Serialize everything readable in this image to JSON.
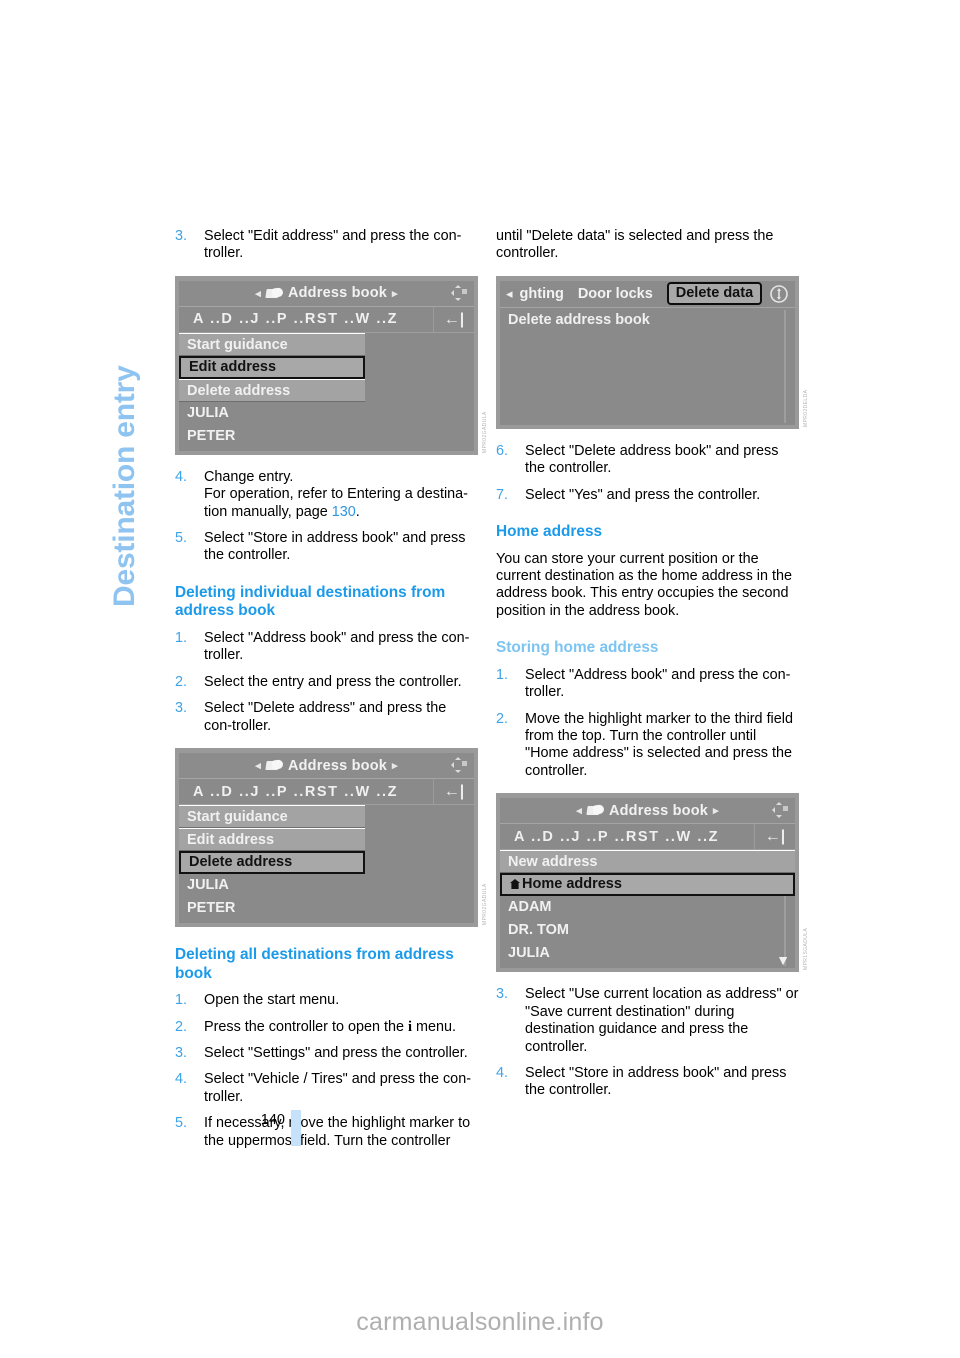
{
  "page": {
    "chapter_title": "Destination entry",
    "page_number": "140",
    "watermark": "carmanualsonline.info"
  },
  "left_column": {
    "step3": {
      "num": "3.",
      "text": "Select \"Edit address\" and press the con-troller."
    },
    "figure1": {
      "title": "Address book",
      "alpha": "A ..D ..J ..P ..RST ..W ..Z",
      "back_arrow": "←|",
      "rows": [
        {
          "label": "Start guidance",
          "state": "boxed"
        },
        {
          "label": "Edit address",
          "state": "selected"
        },
        {
          "label": "Delete address",
          "state": "boxed"
        },
        {
          "label": "JULIA",
          "state": "plain"
        },
        {
          "label": "PETER",
          "state": "plain"
        }
      ],
      "code": "MPR02GADULA"
    },
    "step4": {
      "num": "4.",
      "line1": "Change entry.",
      "line2": "For operation, refer to Entering a destina-tion manually, page ",
      "pageref": "130",
      "line3": "."
    },
    "step5": {
      "num": "5.",
      "text": "Select \"Store in address book\" and press the controller."
    },
    "heading_delete_individual": "Deleting individual destinations from address book",
    "di_step1": {
      "num": "1.",
      "text": "Select \"Address book\" and press the con-troller."
    },
    "di_step2": {
      "num": "2.",
      "text": "Select the entry and press the controller."
    },
    "di_step3": {
      "num": "3.",
      "text": "Select \"Delete address\" and press the con-troller."
    },
    "figure2": {
      "title": "Address book",
      "alpha": "A ..D ..J ..P ..RST ..W ..Z",
      "back_arrow": "←|",
      "rows": [
        {
          "label": "Start guidance",
          "state": "boxed"
        },
        {
          "label": "Edit address",
          "state": "boxed"
        },
        {
          "label": "Delete address",
          "state": "selected"
        },
        {
          "label": "JULIA",
          "state": "plain"
        },
        {
          "label": "PETER",
          "state": "plain"
        }
      ],
      "code": "MPR02GADULA"
    },
    "heading_delete_all": "Deleting all destinations from address book",
    "da_step1": {
      "num": "1.",
      "text": "Open the start menu."
    },
    "da_step2_a": {
      "num": "2.",
      "before": "Press the controller to open the ",
      "icon": "i",
      "after": " menu."
    },
    "da_step3": {
      "num": "3.",
      "text": "Select \"Settings\" and press the controller."
    },
    "da_step4": {
      "num": "4.",
      "text": "Select \"Vehicle / Tires\" and press the con-troller."
    },
    "da_step5": {
      "num": "5.",
      "text": "If necessary, move the highlight marker to the uppermost field. Turn the controller"
    }
  },
  "right_column": {
    "continuation": "until \"Delete data\" is selected and press the controller.",
    "figure3": {
      "tabs": [
        {
          "label": "ghting",
          "state": "normal"
        },
        {
          "label": "Door locks",
          "state": "normal"
        },
        {
          "label": "Delete data",
          "state": "active"
        }
      ],
      "body_text": "Delete address book",
      "code": "MPR02DELDA"
    },
    "da_step6": {
      "num": "6.",
      "text": "Select \"Delete address book\" and press the controller."
    },
    "da_step7": {
      "num": "7.",
      "text": "Select \"Yes\" and press the controller."
    },
    "heading_home_address": "Home address",
    "home_para": "You can store your current position or the current destination as the home address in the address book. This entry occupies the second position in the address book.",
    "heading_storing_home": "Storing home address",
    "sh_step1": {
      "num": "1.",
      "text": "Select \"Address book\" and press the con-troller."
    },
    "sh_step2": {
      "num": "2.",
      "text": "Move the highlight marker to the third field from the top. Turn the controller until \"Home address\" is selected and press the controller."
    },
    "figure4": {
      "title": "Address book",
      "alpha": "A ..D ..J ..P ..RST ..W ..Z",
      "back_arrow": "←|",
      "rows": [
        {
          "label": "New address",
          "state": "boxed",
          "icon": ""
        },
        {
          "label": "Home address",
          "state": "selected",
          "icon": "home-icon"
        },
        {
          "label": "ADAM",
          "state": "plain",
          "icon": ""
        },
        {
          "label": "DR. TOM",
          "state": "plain",
          "icon": ""
        },
        {
          "label": "JULIA",
          "state": "plain",
          "icon": ""
        }
      ],
      "code": "MPR1SGADULA"
    },
    "sh_step3": {
      "num": "3.",
      "text": "Select \"Use current location as address\" or \"Save current destination\" during destination guidance and press the controller."
    },
    "sh_step4": {
      "num": "4.",
      "text": "Select \"Store in address book\" and press the controller."
    }
  },
  "colors": {
    "heading_main": "#1C9AEA",
    "heading_sub": "#7CC4F2",
    "step_number": "#3DA3E8",
    "chapter_title": "#8FC4F0",
    "page_marker": "#C5E2FA",
    "screen_grey": "#8a8a8a"
  }
}
